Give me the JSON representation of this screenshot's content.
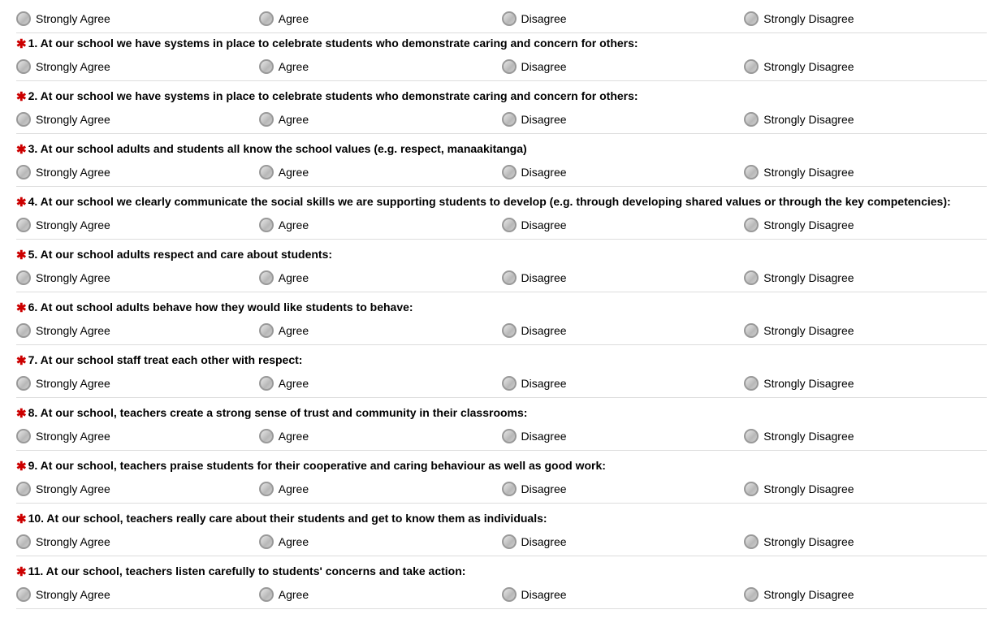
{
  "questions": [
    {
      "id": "q1",
      "number": "1",
      "text": "At our school we have systems in place to celebrate students who demonstrate caring and concern for others:",
      "required": true
    },
    {
      "id": "q2",
      "number": "2",
      "text": "At our school we have systems in place to celebrate students who demonstrate caring and concern for others:",
      "required": true
    },
    {
      "id": "q3",
      "number": "3",
      "text": "At our school adults and students all know the school values (e.g. respect, manaakitanga)",
      "required": true
    },
    {
      "id": "q4",
      "number": "4",
      "text": "At our school we clearly communicate the social skills we are supporting students to develop (e.g. through developing shared values or through the key competencies):",
      "required": true
    },
    {
      "id": "q5",
      "number": "5",
      "text": "At our school adults respect and care about students:",
      "required": true
    },
    {
      "id": "q6",
      "number": "6",
      "text": "At out school adults behave how they would like students to behave:",
      "required": true
    },
    {
      "id": "q7",
      "number": "7",
      "text": "At our school staff treat each other with respect:",
      "required": true
    },
    {
      "id": "q8",
      "number": "8",
      "text": "At our school, teachers create a strong sense of trust and community in their classrooms:",
      "required": true
    },
    {
      "id": "q9",
      "number": "9",
      "text": "At our school, teachers praise students for their cooperative and caring behaviour as well as good work:",
      "required": true
    },
    {
      "id": "q10",
      "number": "10",
      "text": "At our school, teachers really care about their students and get to know them as individuals:",
      "required": true
    },
    {
      "id": "q11",
      "number": "11",
      "text": "At our school, teachers listen carefully to students' concerns and take action:",
      "required": true
    }
  ],
  "options": [
    {
      "value": "strongly_agree",
      "label": "Strongly Agree"
    },
    {
      "value": "agree",
      "label": "Agree"
    },
    {
      "value": "disagree",
      "label": "Disagree"
    },
    {
      "value": "strongly_disagree",
      "label": "Strongly Disagree"
    }
  ],
  "top_row": {
    "strongly_agree": "Strongly Agree",
    "agree": "Agree",
    "disagree": "Disagree",
    "strongly_disagree": "Strongly Disagree"
  }
}
